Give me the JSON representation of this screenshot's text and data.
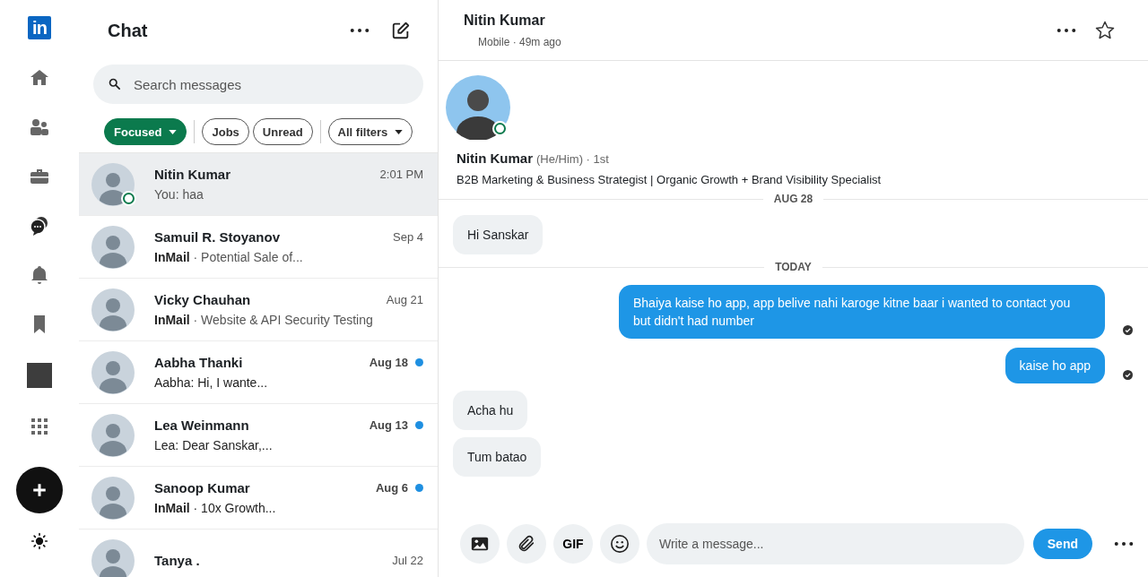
{
  "rail": {
    "logo": "in"
  },
  "list_header": {
    "title": "Chat"
  },
  "search": {
    "placeholder": "Search messages"
  },
  "filters": [
    {
      "label": "Focused",
      "selected": true,
      "dropdown": true
    },
    {
      "label": "Jobs",
      "selected": false,
      "dropdown": false
    },
    {
      "label": "Unread",
      "selected": false,
      "dropdown": false
    },
    {
      "label": "All filters",
      "selected": false,
      "dropdown": true
    }
  ],
  "conversations": [
    {
      "name": "Nitin Kumar",
      "time": "2:01 PM",
      "preview": "You: haa",
      "selected": true,
      "unread": false,
      "online": true
    },
    {
      "name": "Samuil R. Stoyanov",
      "time": "Sep 4",
      "preview": "**InMail** · Potential Sale of...",
      "selected": false,
      "unread": false,
      "online": false
    },
    {
      "name": "Vicky Chauhan",
      "time": "Aug 21",
      "preview": "**InMail** · Website & API Security Testing",
      "selected": false,
      "unread": false,
      "online": false
    },
    {
      "name": "Aabha Thanki",
      "time": "Aug 18",
      "preview": "Aabha: Hi, I wante...",
      "selected": false,
      "unread": true,
      "online": false
    },
    {
      "name": "Lea Weinmann",
      "time": "Aug 13",
      "preview": "Lea: Dear Sanskar,...",
      "selected": false,
      "unread": true,
      "online": false
    },
    {
      "name": "Sanoop Kumar",
      "time": "Aug 6",
      "preview": "**InMail** · 10x Growth...",
      "selected": false,
      "unread": true,
      "online": false
    },
    {
      "name": "Tanya .",
      "time": "Jul 22",
      "selected": false,
      "unread": false,
      "online": false
    }
  ],
  "chat_header": {
    "name": "Nitin Kumar",
    "status": "Mobile · 49m ago"
  },
  "profile": {
    "name": "Nitin Kumar",
    "pronouns": "(He/Him) · 1st",
    "headline": "B2B Marketing & Business Strategist | Organic Growth + Brand Visibility Specialist",
    "online": true
  },
  "messages": [
    {
      "kind": "divider",
      "text": "AUG 28"
    },
    {
      "kind": "received",
      "text": "Hi Sanskar"
    },
    {
      "kind": "divider",
      "text": "TODAY"
    },
    {
      "kind": "sent",
      "text": "Bhaiya kaise ho app, app belive nahi karoge kitne baar i wanted to contact you but didn't had number",
      "read": true
    },
    {
      "kind": "sent",
      "text": "kaise ho app",
      "read": true
    },
    {
      "kind": "received",
      "text": "Acha hu"
    },
    {
      "kind": "received",
      "text": "Tum batao"
    }
  ],
  "composer": {
    "gif": "GIF",
    "placeholder": "Write a message...",
    "send": "Send"
  }
}
